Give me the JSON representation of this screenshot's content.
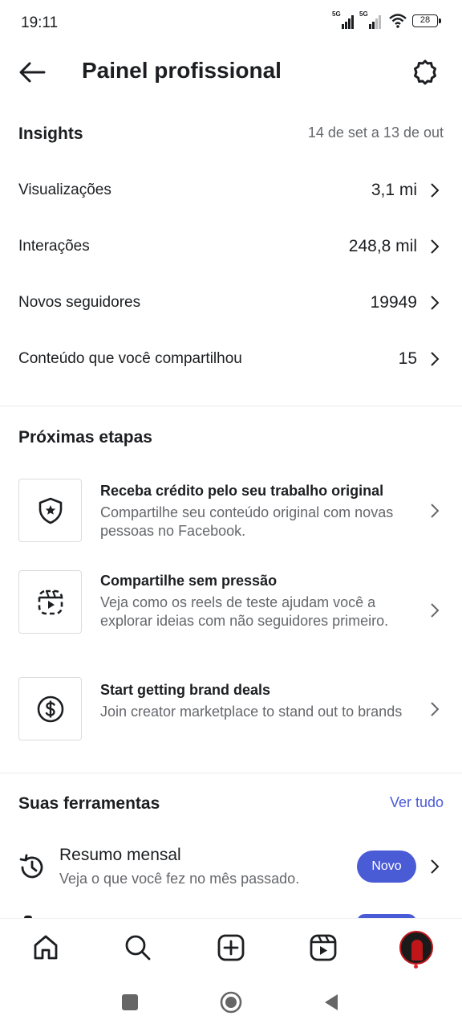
{
  "status_bar": {
    "time": "19:11",
    "network_1": "5G",
    "network_2": "5G",
    "battery": "28"
  },
  "header": {
    "title": "Painel profissional"
  },
  "insights": {
    "title": "Insights",
    "date_range": "14 de set a 13 de out",
    "metrics": [
      {
        "label": "Visualizações",
        "value": "3,1 mi"
      },
      {
        "label": "Interações",
        "value": "248,8 mil"
      },
      {
        "label": "Novos seguidores",
        "value": "19949"
      },
      {
        "label": "Conteúdo que você compartilhou",
        "value": "15"
      }
    ]
  },
  "next_steps": {
    "title": "Próximas etapas",
    "items": [
      {
        "title": "Receba crédito pelo seu trabalho original",
        "description": "Compartilhe seu conteúdo original com novas pessoas no Facebook.",
        "icon": "shield-star-icon"
      },
      {
        "title": "Compartilhe sem pressão",
        "description": "Veja como os reels de teste ajudam você a explorar ideias com não seguidores primeiro.",
        "icon": "reels-trial-icon"
      },
      {
        "title": "Start getting brand deals",
        "description": "Join creator marketplace to stand out to brands",
        "icon": "dollar-icon"
      }
    ]
  },
  "tools": {
    "title": "Suas ferramentas",
    "see_all": "Ver tudo",
    "items": [
      {
        "title": "Resumo mensal",
        "description": "Veja o que você fez no mês passado.",
        "badge": "Novo",
        "icon": "history-icon"
      }
    ]
  },
  "bottom_nav": [
    "home-icon",
    "search-icon",
    "create-icon",
    "reels-icon",
    "profile-avatar"
  ],
  "colors": {
    "accent": "#4a5bd6",
    "text_primary": "#1c1e21",
    "text_secondary": "#65676b",
    "divider": "#ececec"
  }
}
